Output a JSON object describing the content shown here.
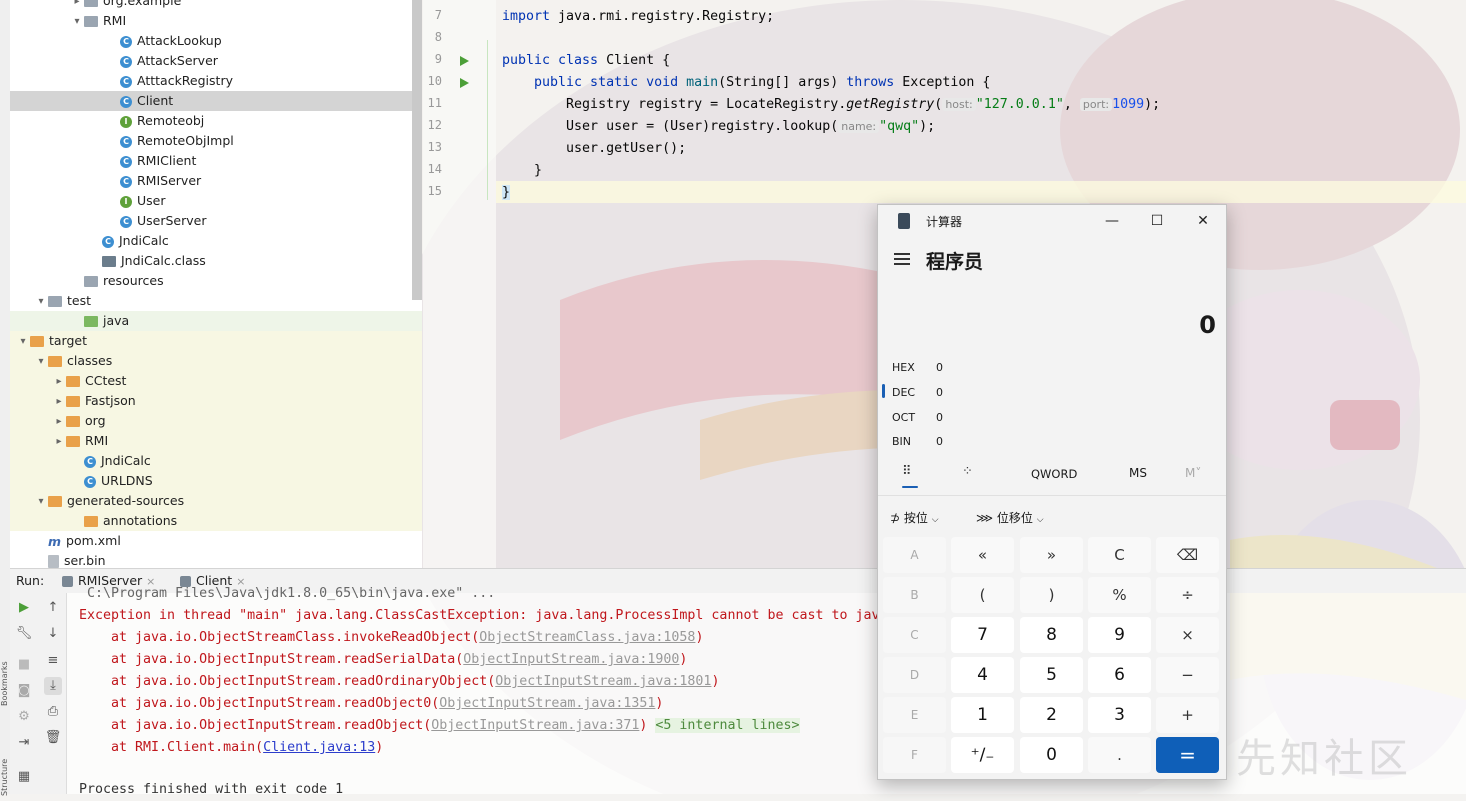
{
  "tree": {
    "items": [
      {
        "label": "org.example",
        "kind": "package",
        "indent": 1
      },
      {
        "label": "RMI",
        "kind": "package",
        "indent": 1,
        "expanded": true
      },
      {
        "label": "AttackLookup",
        "kind": "class",
        "indent": 2
      },
      {
        "label": "AttackServer",
        "kind": "class",
        "indent": 2
      },
      {
        "label": "AtttackRegistry",
        "kind": "class",
        "indent": 2
      },
      {
        "label": "Client",
        "kind": "class",
        "indent": 2,
        "selected": true
      },
      {
        "label": "Remoteobj",
        "kind": "interface",
        "indent": 2
      },
      {
        "label": "RemoteObjImpl",
        "kind": "class",
        "indent": 2
      },
      {
        "label": "RMIClient",
        "kind": "class",
        "indent": 2
      },
      {
        "label": "RMIServer",
        "kind": "class",
        "indent": 2
      },
      {
        "label": "User",
        "kind": "interface",
        "indent": 2
      },
      {
        "label": "UserServer",
        "kind": "class",
        "indent": 2
      },
      {
        "label": "JndiCalc",
        "kind": "class",
        "indent": 1
      },
      {
        "label": "JndiCalc.class",
        "kind": "classfile",
        "indent": 1
      },
      {
        "label": "resources",
        "kind": "folder",
        "indent": 0
      },
      {
        "label": "test",
        "kind": "folder",
        "indent": 0
      },
      {
        "label": "java",
        "kind": "folder-green",
        "indent": 1
      },
      {
        "label": "target",
        "kind": "folder-orange",
        "indent": 0
      },
      {
        "label": "classes",
        "kind": "folder-orange",
        "indent": 1
      },
      {
        "label": "CCtest",
        "kind": "folder-orange",
        "indent": 2
      },
      {
        "label": "Fastjson",
        "kind": "folder-orange",
        "indent": 2
      },
      {
        "label": "org",
        "kind": "folder-orange",
        "indent": 2
      },
      {
        "label": "RMI",
        "kind": "folder-orange",
        "indent": 2
      },
      {
        "label": "JndiCalc",
        "kind": "class",
        "indent": 2
      },
      {
        "label": "URLDNS",
        "kind": "class",
        "indent": 2
      },
      {
        "label": "generated-sources",
        "kind": "folder-orange",
        "indent": 1
      },
      {
        "label": "annotations",
        "kind": "folder-orange",
        "indent": 2
      },
      {
        "label": "pom.xml",
        "kind": "maven",
        "indent": 0
      },
      {
        "label": "ser.bin",
        "kind": "file",
        "indent": 0
      }
    ]
  },
  "editor": {
    "line_numbers": [
      "7",
      "8",
      "9",
      "10",
      "11",
      "12",
      "13",
      "14",
      "15"
    ],
    "lines": {
      "l7": "import java.rmi.registry.Registry;",
      "l9a": "public class ",
      "l9b": "Client {",
      "l10a": "    public static void ",
      "l10b": "main",
      "l10c": "(String[] args) ",
      "l10d": "throws",
      "l10e": " Exception {",
      "l11a": "        Registry registry = LocateRegistry.",
      "l11b": "getRegistry",
      "l11c": "(",
      "l11hint1": "host:",
      "l11str": "\"127.0.0.1\"",
      "l11sep": ", ",
      "l11hint2": "port:",
      "l11num": "1099",
      "l11end": ");",
      "l12a": "        User user = (User)registry.lookup(",
      "l12hint": "name:",
      "l12str": "\"qwq\"",
      "l12end": ");",
      "l13": "        user.getUser();",
      "l14": "    }",
      "l15": "}"
    }
  },
  "runbar": {
    "label": "Run:",
    "tabs": [
      "RMIServer",
      "Client"
    ],
    "close_glyph": "×"
  },
  "console": {
    "path_line": "C:\\Program Files\\Java\\jdk1.8.0_65\\bin\\java.exe\" ...",
    "exception": "Exception in thread \"main\" java.lang.ClassCastException: java.lang.ProcessImpl cannot be cast to jav",
    "stack": [
      {
        "pre": "    at java.io.ObjectStreamClass.invokeReadObject(",
        "link": "ObjectStreamClass.java:1058",
        "post": ")"
      },
      {
        "pre": "    at java.io.ObjectInputStream.readSerialData(",
        "link": "ObjectInputStream.java:1900",
        "post": ")"
      },
      {
        "pre": "    at java.io.ObjectInputStream.readOrdinaryObject(",
        "link": "ObjectInputStream.java:1801",
        "post": ")"
      },
      {
        "pre": "    at java.io.ObjectInputStream.readObject0(",
        "link": "ObjectInputStream.java:1351",
        "post": ")"
      },
      {
        "pre": "    at java.io.ObjectInputStream.readObject(",
        "link": "ObjectInputStream.java:371",
        "post": ") "
      }
    ],
    "internal": "<5 internal lines>",
    "client_pre": "    at RMI.Client.main(",
    "client_link": "Client.java:13",
    "client_post": ")",
    "finished": "Process finished with exit code 1"
  },
  "calculator": {
    "title": "计算器",
    "mode": "程序员",
    "display": "0",
    "radix": [
      {
        "name": "HEX",
        "value": "0"
      },
      {
        "name": "DEC",
        "value": "0"
      },
      {
        "name": "OCT",
        "value": "0"
      },
      {
        "name": "BIN",
        "value": "0"
      }
    ],
    "word_size": "QWORD",
    "ms": "MS",
    "mv": "M˅",
    "bitwise": "按位",
    "bitshift": "位移位",
    "keys": [
      [
        "A",
        "«",
        "»",
        "C",
        "⌫"
      ],
      [
        "B",
        "(",
        ")",
        "%",
        "÷"
      ],
      [
        "C",
        "7",
        "8",
        "9",
        "×"
      ],
      [
        "D",
        "4",
        "5",
        "6",
        "−"
      ],
      [
        "E",
        "1",
        "2",
        "3",
        "+"
      ],
      [
        "F",
        "⁺∕₋",
        "0",
        ".",
        "="
      ]
    ],
    "window_controls": {
      "minimize": "—",
      "maximize": "☐",
      "close": "✕"
    }
  },
  "watermark": "先知社区",
  "side_labels": {
    "bookmarks": "Bookmarks",
    "structure": "Structure"
  }
}
